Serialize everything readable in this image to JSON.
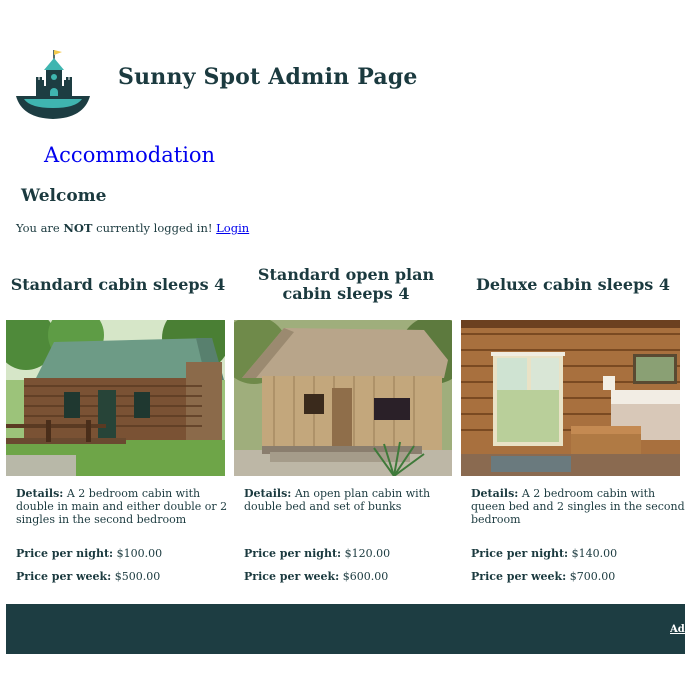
{
  "header": {
    "site_title": "Sunny Spot Admin Page"
  },
  "nav": {
    "accommodation_label": "Accommodation"
  },
  "welcome": {
    "heading": "Welcome",
    "status_prefix": "You are ",
    "status_emphasis": "NOT",
    "status_suffix": " currently logged in! ",
    "login_label": "Login"
  },
  "cabins": [
    {
      "title": "Standard cabin sleeps 4",
      "details_label": "Details:",
      "details_text": " A 2 bedroom cabin with double in main and either double or 2 singles in the second bedroom",
      "price_night_label": "Price per night:",
      "price_night": " $100.00",
      "price_week_label": "Price per week:",
      "price_week": " $500.00"
    },
    {
      "title": "Standard open plan cabin sleeps 4",
      "details_label": "Details:",
      "details_text": " An open plan cabin with double bed and set of bunks",
      "price_night_label": "Price per night:",
      "price_night": " $120.00",
      "price_week_label": "Price per week:",
      "price_week": " $600.00"
    },
    {
      "title": "Deluxe cabin sleeps 4",
      "details_label": "Details:",
      "details_text": " A 2 bedroom cabin with queen bed and 2 singles in the second bedroom",
      "price_night_label": "Price per night:",
      "price_night": " $140.00",
      "price_week_label": "Price per week:",
      "price_week": " $700.00"
    }
  ],
  "footer": {
    "link_label": "Admin"
  },
  "colors": {
    "brand_dark": "#1d3d42",
    "teal_accent": "#3fb5b0",
    "link_blue": "#0000ee"
  }
}
